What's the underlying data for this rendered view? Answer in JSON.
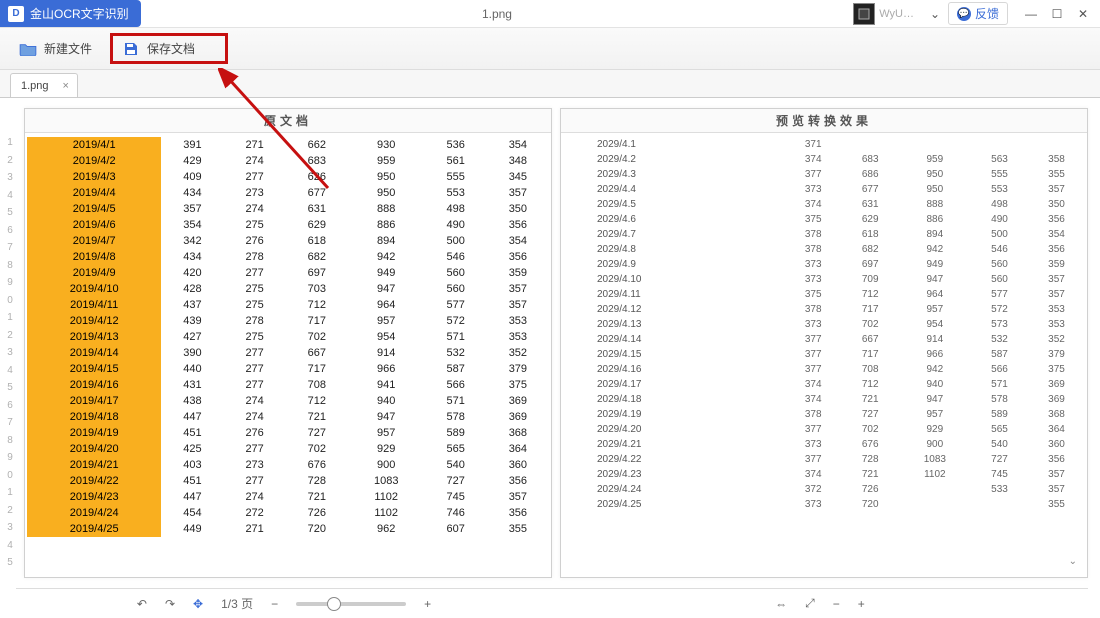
{
  "titlebar": {
    "app_name": "金山OCR文字识别",
    "doc_name": "1.png",
    "user_name": "WyU…",
    "feedback_label": "反馈"
  },
  "toolbar": {
    "open_label": "新建文件",
    "save_label": "保存文档"
  },
  "tab": {
    "label": "1.png"
  },
  "panes": {
    "left_title": "原文档",
    "right_title": "预览转换效果"
  },
  "gutter_rows": [
    "1",
    "2",
    "3",
    "4",
    "5",
    "6",
    "7",
    "8",
    "9",
    "0",
    "1",
    "2",
    "3",
    "4",
    "5",
    "6",
    "7",
    "8",
    "9",
    "0",
    "1",
    "2",
    "3",
    "4",
    "5"
  ],
  "left_rows": [
    {
      "date": "2019/4/1",
      "c": [
        "391",
        "271",
        "662",
        "930",
        "536",
        "354"
      ]
    },
    {
      "date": "2019/4/2",
      "c": [
        "429",
        "274",
        "683",
        "959",
        "561",
        "348"
      ]
    },
    {
      "date": "2019/4/3",
      "c": [
        "409",
        "277",
        "626",
        "950",
        "555",
        "345"
      ]
    },
    {
      "date": "2019/4/4",
      "c": [
        "434",
        "273",
        "677",
        "950",
        "553",
        "357"
      ]
    },
    {
      "date": "2019/4/5",
      "c": [
        "357",
        "274",
        "631",
        "888",
        "498",
        "350"
      ]
    },
    {
      "date": "2019/4/6",
      "c": [
        "354",
        "275",
        "629",
        "886",
        "490",
        "356"
      ]
    },
    {
      "date": "2019/4/7",
      "c": [
        "342",
        "276",
        "618",
        "894",
        "500",
        "354"
      ]
    },
    {
      "date": "2019/4/8",
      "c": [
        "434",
        "278",
        "682",
        "942",
        "546",
        "356"
      ]
    },
    {
      "date": "2019/4/9",
      "c": [
        "420",
        "277",
        "697",
        "949",
        "560",
        "359"
      ]
    },
    {
      "date": "2019/4/10",
      "c": [
        "428",
        "275",
        "703",
        "947",
        "560",
        "357"
      ]
    },
    {
      "date": "2019/4/11",
      "c": [
        "437",
        "275",
        "712",
        "964",
        "577",
        "357"
      ]
    },
    {
      "date": "2019/4/12",
      "c": [
        "439",
        "278",
        "717",
        "957",
        "572",
        "353"
      ]
    },
    {
      "date": "2019/4/13",
      "c": [
        "427",
        "275",
        "702",
        "954",
        "571",
        "353"
      ]
    },
    {
      "date": "2019/4/14",
      "c": [
        "390",
        "277",
        "667",
        "914",
        "532",
        "352"
      ]
    },
    {
      "date": "2019/4/15",
      "c": [
        "440",
        "277",
        "717",
        "966",
        "587",
        "379"
      ]
    },
    {
      "date": "2019/4/16",
      "c": [
        "431",
        "277",
        "708",
        "941",
        "566",
        "375"
      ]
    },
    {
      "date": "2019/4/17",
      "c": [
        "438",
        "274",
        "712",
        "940",
        "571",
        "369"
      ]
    },
    {
      "date": "2019/4/18",
      "c": [
        "447",
        "274",
        "721",
        "947",
        "578",
        "369"
      ]
    },
    {
      "date": "2019/4/19",
      "c": [
        "451",
        "276",
        "727",
        "957",
        "589",
        "368"
      ]
    },
    {
      "date": "2019/4/20",
      "c": [
        "425",
        "277",
        "702",
        "929",
        "565",
        "364"
      ]
    },
    {
      "date": "2019/4/21",
      "c": [
        "403",
        "273",
        "676",
        "900",
        "540",
        "360"
      ]
    },
    {
      "date": "2019/4/22",
      "c": [
        "451",
        "277",
        "728",
        "1083",
        "727",
        "356"
      ]
    },
    {
      "date": "2019/4/23",
      "c": [
        "447",
        "274",
        "721",
        "1102",
        "745",
        "357"
      ]
    },
    {
      "date": "2019/4/24",
      "c": [
        "454",
        "272",
        "726",
        "1102",
        "746",
        "356"
      ]
    },
    {
      "date": "2019/4/25",
      "c": [
        "449",
        "271",
        "720",
        "962",
        "607",
        "355"
      ]
    }
  ],
  "right_rows": [
    {
      "date": "2029/4.1",
      "c": [
        "371",
        "",
        "",
        "",
        ""
      ]
    },
    {
      "date": "2029/4.2",
      "c": [
        "374",
        "683",
        "959",
        "563",
        "358"
      ]
    },
    {
      "date": "2029/4.3",
      "c": [
        "377",
        "686",
        "950",
        "555",
        "355"
      ]
    },
    {
      "date": "2029/4.4",
      "c": [
        "373",
        "677",
        "950",
        "553",
        "357"
      ]
    },
    {
      "date": "2029/4.5",
      "c": [
        "374",
        "631",
        "888",
        "498",
        "350"
      ]
    },
    {
      "date": "2029/4.6",
      "c": [
        "375",
        "629",
        "886",
        "490",
        "356"
      ]
    },
    {
      "date": "2029/4.7",
      "c": [
        "378",
        "618",
        "894",
        "500",
        "354"
      ]
    },
    {
      "date": "2029/4.8",
      "c": [
        "378",
        "682",
        "942",
        "546",
        "356"
      ]
    },
    {
      "date": "2029/4.9",
      "c": [
        "373",
        "697",
        "949",
        "560",
        "359"
      ]
    },
    {
      "date": "2029/4.10",
      "c": [
        "373",
        "709",
        "947",
        "560",
        "357"
      ]
    },
    {
      "date": "2029/4.11",
      "c": [
        "375",
        "712",
        "964",
        "577",
        "357"
      ]
    },
    {
      "date": "2029/4.12",
      "c": [
        "378",
        "717",
        "957",
        "572",
        "353"
      ]
    },
    {
      "date": "2029/4.13",
      "c": [
        "373",
        "702",
        "954",
        "573",
        "353"
      ]
    },
    {
      "date": "2029/4.14",
      "c": [
        "377",
        "667",
        "914",
        "532",
        "352"
      ]
    },
    {
      "date": "2029/4.15",
      "c": [
        "377",
        "717",
        "966",
        "587",
        "379"
      ]
    },
    {
      "date": "2029/4.16",
      "c": [
        "377",
        "708",
        "942",
        "566",
        "375"
      ]
    },
    {
      "date": "2029/4.17",
      "c": [
        "374",
        "712",
        "940",
        "571",
        "369"
      ]
    },
    {
      "date": "2029/4.18",
      "c": [
        "374",
        "721",
        "947",
        "578",
        "369"
      ]
    },
    {
      "date": "2029/4.19",
      "c": [
        "378",
        "727",
        "957",
        "589",
        "368"
      ]
    },
    {
      "date": "2029/4.20",
      "c": [
        "377",
        "702",
        "929",
        "565",
        "364"
      ]
    },
    {
      "date": "2029/4.21",
      "c": [
        "373",
        "676",
        "900",
        "540",
        "360"
      ]
    },
    {
      "date": "2029/4.22",
      "c": [
        "377",
        "728",
        "1083",
        "727",
        "356"
      ]
    },
    {
      "date": "2029/4.23",
      "c": [
        "374",
        "721",
        "1102",
        "745",
        "357"
      ]
    },
    {
      "date": "2029/4.24",
      "c": [
        "372",
        "726",
        "",
        "533",
        "357"
      ]
    },
    {
      "date": "2029/4.25",
      "c": [
        "373",
        "720",
        "",
        "",
        "355"
      ]
    }
  ],
  "footer_left": {
    "page_indicator": "1/3 页"
  }
}
